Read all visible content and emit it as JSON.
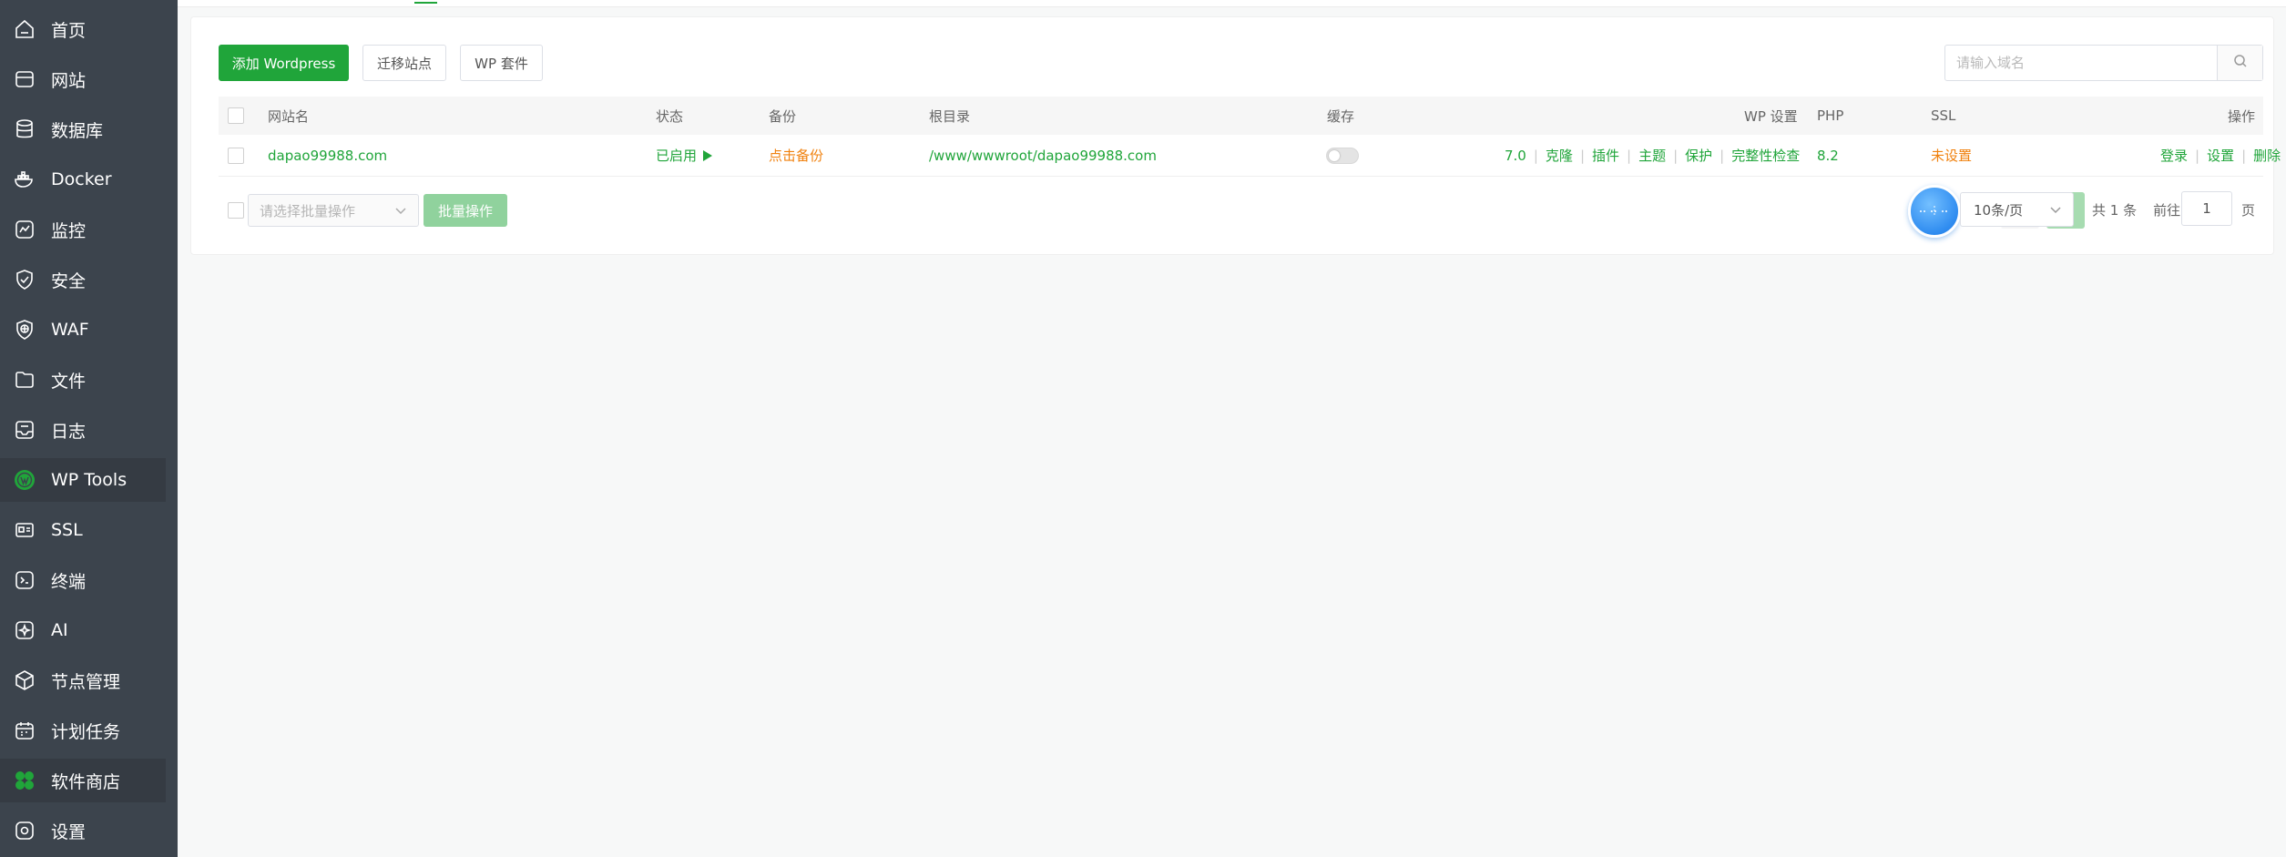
{
  "sidebar": {
    "items": [
      {
        "label": "首页",
        "icon": "home-icon"
      },
      {
        "label": "网站",
        "icon": "globe-icon"
      },
      {
        "label": "数据库",
        "icon": "database-icon"
      },
      {
        "label": "Docker",
        "icon": "docker-icon"
      },
      {
        "label": "监控",
        "icon": "monitor-icon"
      },
      {
        "label": "安全",
        "icon": "shield-icon"
      },
      {
        "label": "WAF",
        "icon": "waf-icon"
      },
      {
        "label": "文件",
        "icon": "folder-icon"
      },
      {
        "label": "日志",
        "icon": "log-icon"
      },
      {
        "label": "WP Tools",
        "icon": "wordpress-icon",
        "active": true
      },
      {
        "label": "SSL",
        "icon": "ssl-icon"
      },
      {
        "label": "终端",
        "icon": "terminal-icon"
      },
      {
        "label": "AI",
        "icon": "ai-icon"
      },
      {
        "label": "节点管理",
        "icon": "node-icon"
      },
      {
        "label": "计划任务",
        "icon": "calendar-icon"
      },
      {
        "label": "软件商店",
        "icon": "app-store-icon",
        "active": true
      },
      {
        "label": "设置",
        "icon": "settings-icon"
      }
    ]
  },
  "toolbar": {
    "add_label": "添加 Wordpress",
    "migrate_label": "迁移站点",
    "suite_label": "WP 套件",
    "search_placeholder": "请输入域名"
  },
  "table": {
    "headers": {
      "name": "网站名",
      "status": "状态",
      "backup": "备份",
      "root": "根目录",
      "cache": "缓存",
      "wp_settings": "WP 设置",
      "php": "PHP",
      "ssl": "SSL",
      "actions": "操作"
    },
    "rows": [
      {
        "name": "dapao99988.com",
        "status": "已启用",
        "backup": "点击备份",
        "root": "/www/wwwroot/dapao99988.com",
        "cache_enabled": false,
        "wp_version": "7.0",
        "wp_links": [
          "克隆",
          "插件",
          "主题",
          "保护",
          "完整性检查"
        ],
        "php": "8.2",
        "ssl": "未设置",
        "actions": [
          "登录",
          "设置",
          "删除"
        ]
      }
    ]
  },
  "footer": {
    "batch_placeholder": "请选择批量操作",
    "batch_button": "批量操作",
    "current_page": "1",
    "page_size": "10条/页",
    "total": "共 1 条",
    "goto": "前往",
    "goto_value": "1",
    "page_unit": "页"
  },
  "colors": {
    "primary": "#20a53a",
    "warning": "#f0810e",
    "sidebar_bg": "#3c444d"
  }
}
